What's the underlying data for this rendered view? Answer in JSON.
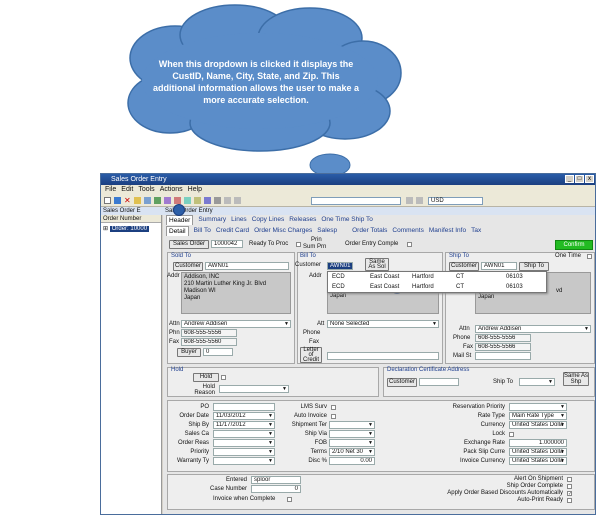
{
  "callout": {
    "text": "When this dropdown is clicked it displays the CustID, Name, City, State, and Zip.  This additional information allows the user to make a more accurate selection."
  },
  "window": {
    "title": "Sales Order Entry",
    "menu": [
      "File",
      "Edit",
      "Tools",
      "Actions",
      "Help"
    ],
    "toolbar_currency": "USD",
    "subbar_left": "Sales Order E",
    "subbar_right": "Sales Order Entry",
    "min_icon": "_",
    "max_icon": "□",
    "close_icon": "x"
  },
  "tree": {
    "header": "Order Number",
    "selected": "Order: 10000"
  },
  "tabs_top": [
    "Header",
    "Summary",
    "Lines",
    "Copy Lines",
    "Releases",
    "One Time Ship To"
  ],
  "tabs_sub": [
    "Detail",
    "Bill To",
    "Credit Card",
    "Order Misc Charges",
    "Salesp",
    "Order Totals",
    "Comments",
    "Manifest Info",
    "Tax"
  ],
  "order_bar": {
    "sales_order_btn": "Sales Order",
    "order_no": "1000042",
    "ready_to_proc": "Ready To Proc",
    "print_sum": "Prin",
    "sum_prn": "Sum Prn",
    "complete": "Order Entry Comple",
    "confirm": "Confirm"
  },
  "sold_to": {
    "section": "Sold To",
    "customer_btn": "Customer",
    "customer_value": "AWN01",
    "addr_label": "Addr",
    "address_lines": [
      "Addison, INC",
      "210 Martin Luther King Jr. Blvd",
      "Madison WI",
      "Japan"
    ],
    "attn_label": "Attn",
    "attn_value": "Andrew Addisen",
    "phn_label": "Phn",
    "phn_value": "608-555-5556",
    "fax_label": "Fax",
    "fax_value": "608-555-5560",
    "buyer_btn": "Buyer",
    "buyer_value": "0"
  },
  "bill_to": {
    "section": "Bill To",
    "customer_label": "Customer",
    "customer_value": "AWN01",
    "same_as_sol": "Same As Sol",
    "addr_label": "Addr",
    "address_line": "Japan",
    "attn_label": "Att",
    "attn_value": "None Selected",
    "phone_label": "Phone",
    "fax_label": "Fax",
    "letter_btn": "Letter of Credit"
  },
  "popup": {
    "rows": [
      {
        "id": "ECD",
        "name": "East Coast",
        "city": "Hartford",
        "state": "CT",
        "zip": "06103"
      },
      {
        "id": "ECD",
        "name": "East Coast",
        "city": "Hartford",
        "state": "CT",
        "zip": "06103"
      }
    ]
  },
  "ship_to": {
    "section": "Ship To",
    "one_time": "One Time",
    "customer_btn": "Customer",
    "customer_value": "AWN01",
    "ship_to_btn": "Ship To",
    "addr_tail": "vd",
    "address_lines": [
      "Madison WI",
      "Japan"
    ],
    "attn_label": "Attn",
    "attn_value": "Andrew Addisen",
    "phone_label": "Phone",
    "phone_value": "608-555-5556",
    "fax_label": "Fax",
    "fax_value": "608-555-5566",
    "mail_label": "Mail St"
  },
  "hold": {
    "section": "Hold",
    "hold_btn": "Hold",
    "hold_reason_label": "Hold Reason"
  },
  "dec": {
    "section": "Declaration Certificate Address",
    "customer_btn": "Customer",
    "ship_to_label": "Ship To",
    "same_as_shp": "Same As Shp"
  },
  "details_left": [
    {
      "label": "PO",
      "value": ""
    },
    {
      "label": "Order Date",
      "value": "11/03/2012"
    },
    {
      "label": "Ship By",
      "value": "11/17/2012"
    },
    {
      "label": "Sales Ca",
      "value": ""
    },
    {
      "label": "Order Reas",
      "value": ""
    },
    {
      "label": "Priority",
      "value": ""
    },
    {
      "label": "Warranty Ty",
      "value": ""
    }
  ],
  "details_mid": [
    {
      "label": "LMS Surv",
      "value": ""
    },
    {
      "label": "Auto Invoice",
      "value": ""
    },
    {
      "label": "Shipment Ter",
      "value": ""
    },
    {
      "label": "Ship Via",
      "value": ""
    },
    {
      "label": "FOB",
      "value": ""
    },
    {
      "label": "Terms",
      "value": "2/10 Net 30"
    },
    {
      "label": "Disc %",
      "value": "0.00"
    }
  ],
  "details_right": [
    {
      "label": "Reservation Priority",
      "value": ""
    },
    {
      "label": "Rate Type",
      "value": "Main Rate Type"
    },
    {
      "label": "Currency",
      "value": "United States Dolla"
    },
    {
      "label": "Lock",
      "value": ""
    },
    {
      "label": "Exchange Rate",
      "value": "1.000000"
    },
    {
      "label": "Pack Slip Curre",
      "value": "United States Dolla"
    },
    {
      "label": "Invoice Currency",
      "value": "United States Dolla"
    }
  ],
  "bottom": {
    "entered_label": "Entered",
    "entered_value": "sploor",
    "case_label": "Case Number",
    "case_value": "0",
    "invoice_when_complete": "Invoice when Complete",
    "alert_on_shipment": "Alert On Shipment",
    "ship_order_complete": "Ship Order Complete",
    "apply_discounts": "Apply Order Based Discounts Automatically",
    "auto_print": "Auto-Print Ready"
  }
}
